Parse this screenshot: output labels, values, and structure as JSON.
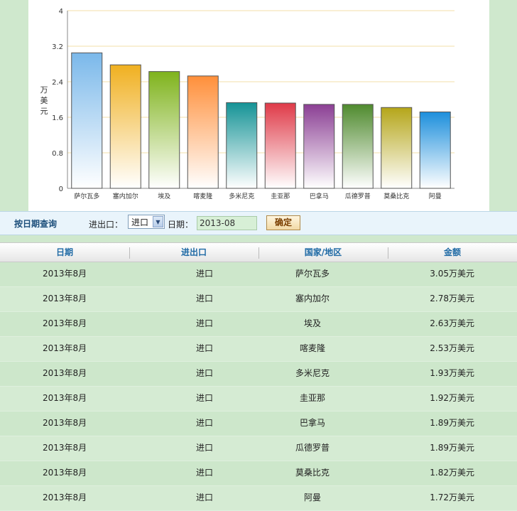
{
  "chart_data": {
    "type": "bar",
    "categories": [
      "萨尔瓦多",
      "塞内加尔",
      "埃及",
      "喀麦隆",
      "多米尼克",
      "圭亚那",
      "巴拿马",
      "瓜德罗普",
      "莫桑比克",
      "阿曼"
    ],
    "values": [
      3.05,
      2.78,
      2.63,
      2.53,
      1.93,
      1.92,
      1.89,
      1.89,
      1.82,
      1.72
    ],
    "ylabel": "万美元",
    "ylim": [
      0,
      4
    ],
    "yticks": [
      "0",
      "0.8",
      "1.6",
      "2.4",
      "3.2",
      "4"
    ],
    "grid": true,
    "colors": [
      "#7ab8ea",
      "#f0b020",
      "#7fb31c",
      "#ff8f3a",
      "#159396",
      "#df3a48",
      "#8b3f94",
      "#4f8a2e",
      "#b5a61a",
      "#1d8fdc"
    ]
  },
  "query": {
    "title": "按日期查询",
    "direction_label": "进出口：",
    "direction_value": "进口",
    "date_label": "日期：",
    "date_value": "2013-08",
    "confirm_label": "确定"
  },
  "table": {
    "headers": [
      "日期",
      "进出口",
      "国家/地区",
      "金额"
    ],
    "rows": [
      [
        "2013年8月",
        "进口",
        "萨尔瓦多",
        "3.05万美元"
      ],
      [
        "2013年8月",
        "进口",
        "塞内加尔",
        "2.78万美元"
      ],
      [
        "2013年8月",
        "进口",
        "埃及",
        "2.63万美元"
      ],
      [
        "2013年8月",
        "进口",
        "喀麦隆",
        "2.53万美元"
      ],
      [
        "2013年8月",
        "进口",
        "多米尼克",
        "1.93万美元"
      ],
      [
        "2013年8月",
        "进口",
        "圭亚那",
        "1.92万美元"
      ],
      [
        "2013年8月",
        "进口",
        "巴拿马",
        "1.89万美元"
      ],
      [
        "2013年8月",
        "进口",
        "瓜德罗普",
        "1.89万美元"
      ],
      [
        "2013年8月",
        "进口",
        "莫桑比克",
        "1.82万美元"
      ],
      [
        "2013年8月",
        "进口",
        "阿曼",
        "1.72万美元"
      ]
    ]
  }
}
